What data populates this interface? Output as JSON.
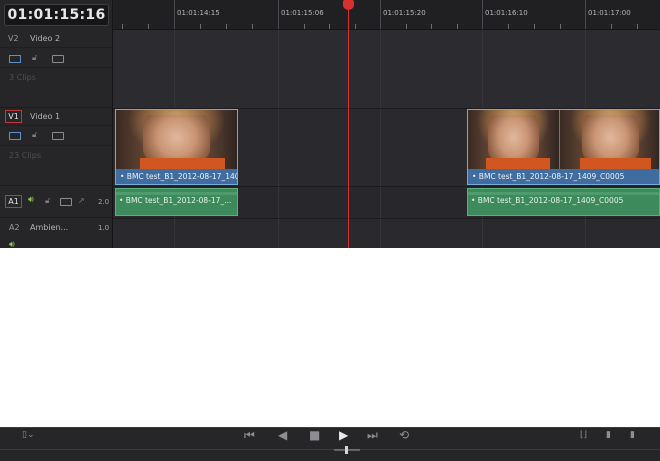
{
  "timeline": {
    "timecode": "01:01:15:16",
    "ruler_labels": [
      "01:01:14:15",
      "01:01:15:06",
      "01:01:15:20",
      "01:01:16:10",
      "01:01:17:00"
    ]
  },
  "tracks": {
    "v2": {
      "id": "V2",
      "name": "Video 2",
      "clip_count": "3 Clips"
    },
    "v1": {
      "id": "V1",
      "name": "Video 1",
      "clip_count": "23 Clips"
    },
    "a1": {
      "id": "A1",
      "level": "2.0"
    },
    "a2": {
      "id": "A2",
      "name": "Ambien...",
      "level": "1.0"
    }
  },
  "clips": {
    "video_left": "• BMC test_B1_2012-08-17_140...",
    "video_right": "• BMC test_B1_2012-08-17_1409_C0005",
    "audio_left": "• BMC test_B1_2012-08-17_...",
    "audio_right": "• BMC test_B1_2012-08-17_1409_C0005"
  },
  "colors": {
    "playhead": "#d8312d",
    "video_clip": "#4f7fb3",
    "audio_clip": "#3d8a5c",
    "record_badge": "#c23838"
  },
  "icons": {
    "monitor": "monitor-icon",
    "lock": "lock-icon",
    "auto_select": "auto-select-icon",
    "speaker": "speaker-icon",
    "go_to_start": "skip-to-start-icon",
    "reverse": "play-reverse-icon",
    "stop": "stop-icon",
    "play": "play-icon",
    "go_to_end": "skip-to-end-icon",
    "loop": "loop-icon"
  },
  "transport": {
    "go_to_start": "⏮",
    "reverse": "◀",
    "stop": "■",
    "play": "▶",
    "go_to_end": "⏭",
    "loop": "⟲"
  }
}
